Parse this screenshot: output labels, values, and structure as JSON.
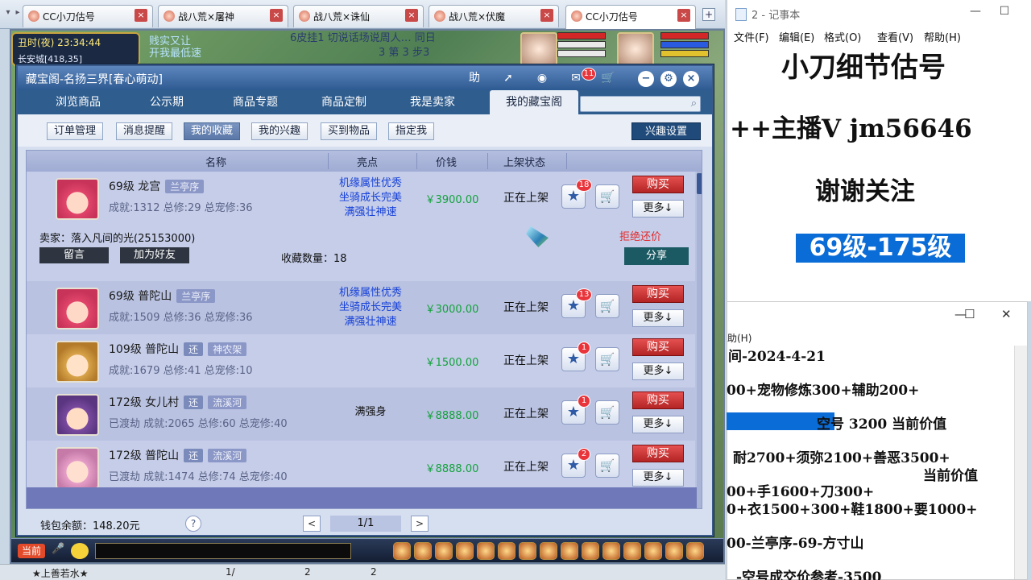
{
  "browser": {
    "tabs": [
      {
        "label": "CC小刀估号",
        "active": false
      },
      {
        "label": "战八荒×屠神",
        "active": false
      },
      {
        "label": "战八荒×诛仙",
        "active": false
      },
      {
        "label": "战八荒×伏魔",
        "active": false
      },
      {
        "label": "CC小刀估号",
        "active": true
      }
    ],
    "close_glyph": "×",
    "plus_glyph": "+"
  },
  "game": {
    "clock_time": "丑时(夜)  23:34:44",
    "city": "长安城[418,35]",
    "scene_text_1": "贱实又让",
    "scene_text_2": "开我最低速",
    "scene_text_3": "6皮挂1      切说话场说周人…  同日",
    "scene_text_4": "3 第 3 步3",
    "chat_mode": "当前"
  },
  "dialog": {
    "title": "藏宝阁-名扬三界[春心萌动]",
    "title_icons": [
      "help-icon",
      "share-icon",
      "record-icon",
      "chat-icon",
      "cart-icon"
    ],
    "title_help_label": "助",
    "chat_badge": "11",
    "nav_tabs": [
      "浏览商品",
      "公示期",
      "商品专题",
      "商品定制",
      "我是卖家",
      "我的藏宝阁"
    ],
    "active_nav": "我的藏宝阁",
    "search_placeholder": "",
    "sub_tabs": [
      "订单管理",
      "消息提醒",
      "我的收藏",
      "我的兴趣",
      "买到物品",
      "指定我"
    ],
    "active_sub": "我的收藏",
    "interest_settings": "兴趣设置",
    "columns": {
      "name": "名称",
      "highlight": "亮点",
      "price": "价钱",
      "status": "上架状态"
    },
    "rows": [
      {
        "name": "69级 龙宫",
        "tags": [
          "兰亭序"
        ],
        "stats": "成就:1312 总修:29 总宠修:36",
        "highlights": [
          "机缘属性优秀",
          "坐骑成长完美",
          "满强壮神速"
        ],
        "price": "￥3900.00",
        "status": "正在上架",
        "fav_count": "18",
        "buy": "购买",
        "more": "更多↓"
      },
      {
        "name": "69级 普陀山",
        "tags": [
          "兰亭序"
        ],
        "stats": "成就:1509 总修:36 总宠修:36",
        "highlights": [
          "机缘属性优秀",
          "坐骑成长完美",
          "满强壮神速"
        ],
        "price": "￥3000.00",
        "status": "正在上架",
        "fav_count": "13",
        "buy": "购买",
        "more": "更多↓"
      },
      {
        "name": "109级 普陀山",
        "tags": [
          "还",
          "神农架"
        ],
        "stats": "成就:1679 总修:41 总宠修:10",
        "highlights": [],
        "price": "￥1500.00",
        "status": "正在上架",
        "fav_count": "1",
        "buy": "购买",
        "more": "更多↓"
      },
      {
        "name": "172级 女儿村",
        "tags": [
          "还",
          "流溪河"
        ],
        "stats": "已渡劫 成就:2065 总修:60 总宠修:40",
        "highlights": [
          "满强身"
        ],
        "price": "￥8888.00",
        "status": "正在上架",
        "fav_count": "1",
        "buy": "购买",
        "more": "更多↓"
      },
      {
        "name": "172级 普陀山",
        "tags": [
          "还",
          "流溪河"
        ],
        "stats": "已渡劫 成就:1474 总修:74 总宠修:40",
        "highlights": [],
        "price": "￥8888.00",
        "status": "正在上架",
        "fav_count": "2",
        "buy": "购买",
        "more": "更多↓"
      }
    ],
    "expanded": {
      "seller": "卖家：落入凡间的光(25153000)",
      "refuse": "拒绝还价",
      "message": "留言",
      "add_friend": "加为好友",
      "fav_count": "收藏数量：18",
      "share": "分享"
    },
    "footer": {
      "wallet": "钱包余额：148.20元",
      "help": "?",
      "prev": "<",
      "next": ">",
      "page": "1/1"
    }
  },
  "notepad1": {
    "title": "2 - 记事本",
    "menu": [
      "文件(F)",
      "编辑(E)",
      "格式(O)",
      "查看(V)",
      "帮助(H)"
    ],
    "line1": "小刀细节估号",
    "line2": "++主播V  jm56646",
    "line3": "谢谢关注",
    "line4": "69级-175级"
  },
  "notepad2": {
    "menu_fragment": "助(H)",
    "lines": [
      "间-2024-4-21",
      "00+宠物修炼300+辅助200+",
      "空号  3200  当前价值",
      "耐2700+须弥2100+善恶3500+",
      "当前价值",
      "00+手1600+刀300+",
      "0+衣1500+300+鞋1800+要1000+",
      "00-兰亭序-69-方寸山",
      "-空号成交价参考-3500"
    ]
  },
  "taskbar": {
    "item1": "★上善若水★",
    "item2": "1/",
    "item3": "2",
    "item4": "2"
  }
}
